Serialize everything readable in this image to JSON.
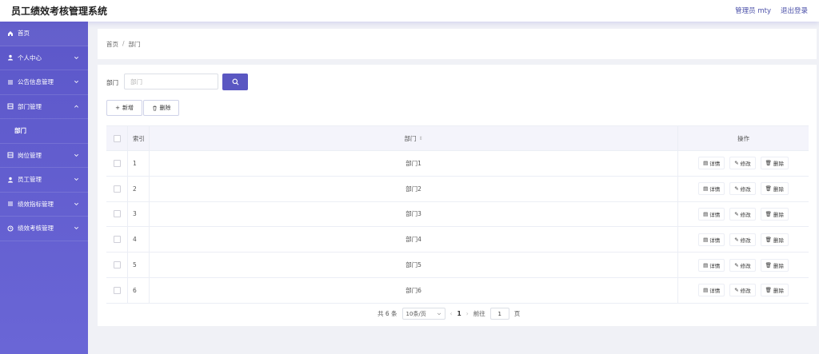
{
  "app": {
    "title": "员工绩效考核管理系统"
  },
  "header": {
    "user_label": "管理员 mty",
    "logout_label": "退出登录"
  },
  "sidebar": {
    "items": [
      {
        "label": "首页",
        "icon": "home-icon"
      },
      {
        "label": "个人中心",
        "icon": "user-icon"
      },
      {
        "label": "公告信息管理",
        "icon": "list-icon"
      },
      {
        "label": "部门管理",
        "icon": "grid-icon"
      },
      {
        "label": "部门",
        "icon": ""
      },
      {
        "label": "岗位管理",
        "icon": "grid-icon"
      },
      {
        "label": "员工管理",
        "icon": "user-icon"
      },
      {
        "label": "绩效指标管理",
        "icon": "list-icon"
      },
      {
        "label": "绩效考核管理",
        "icon": "clock-icon"
      }
    ]
  },
  "breadcrumb": {
    "home": "首页",
    "separator": "/",
    "current": "部门"
  },
  "search": {
    "label": "部门",
    "placeholder": "部门",
    "value": ""
  },
  "toolbar": {
    "add_label": "新增",
    "delete_label": "删除"
  },
  "table": {
    "columns": {
      "index": "索引",
      "dept": "部门",
      "ops": "操作"
    },
    "rows": [
      {
        "index": "1",
        "dept": "部门1"
      },
      {
        "index": "2",
        "dept": "部门2"
      },
      {
        "index": "3",
        "dept": "部门3"
      },
      {
        "index": "4",
        "dept": "部门4"
      },
      {
        "index": "5",
        "dept": "部门5"
      },
      {
        "index": "6",
        "dept": "部门6"
      }
    ],
    "row_actions": {
      "detail": "详情",
      "edit": "修改",
      "delete": "删除"
    }
  },
  "pagination": {
    "total_text": "共 6 条",
    "page_size": "10条/页",
    "current_page": "1",
    "goto_label": "前往",
    "goto_value": "1",
    "page_suffix": "页"
  },
  "colors": {
    "sidebar": "#5c57c9",
    "accent": "#5a57c2"
  }
}
